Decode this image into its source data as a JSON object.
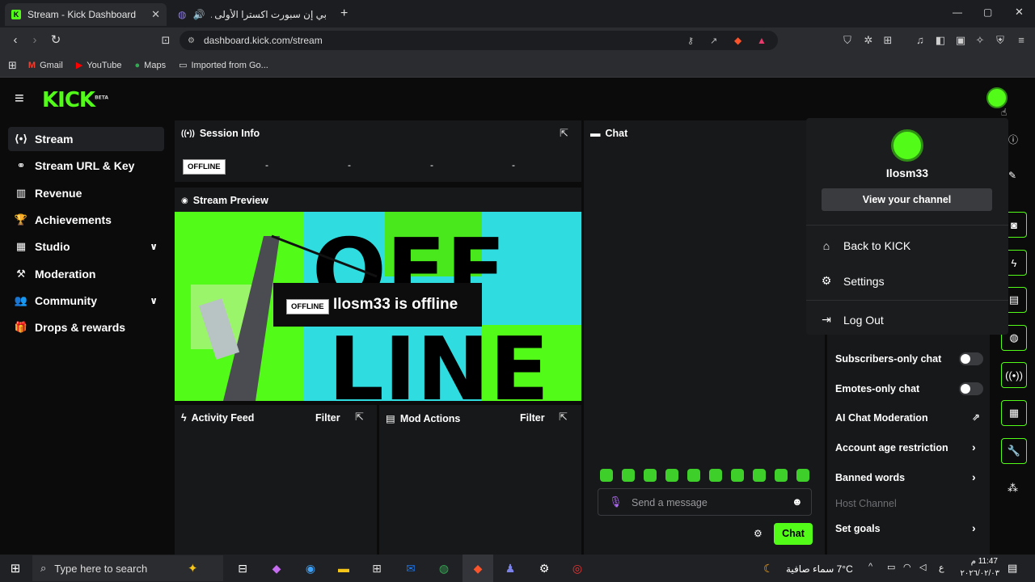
{
  "browser": {
    "tabs": [
      {
        "title": "Stream - Kick Dashboard",
        "active": true
      },
      {
        "title": "بي إن سبورت اكسترا الأولى PANDA",
        "active": false
      }
    ],
    "url": "dashboard.kick.com/stream",
    "bookmarks": [
      "Gmail",
      "YouTube",
      "Maps",
      "Imported from Go..."
    ]
  },
  "app": {
    "logo": "KICK",
    "logo_badge": "BETA",
    "sidebar": {
      "items": [
        {
          "label": "Stream",
          "icon": "broadcast-icon"
        },
        {
          "label": "Stream URL & Key",
          "icon": "link-icon"
        },
        {
          "label": "Revenue",
          "icon": "chart-icon"
        },
        {
          "label": "Achievements",
          "icon": "trophy-icon"
        },
        {
          "label": "Studio",
          "icon": "studio-icon"
        },
        {
          "label": "Moderation",
          "icon": "hammer-icon"
        },
        {
          "label": "Community",
          "icon": "people-icon"
        },
        {
          "label": "Drops & rewards",
          "icon": "gift-icon"
        }
      ]
    },
    "session": {
      "title": "Session Info",
      "status": "OFFLINE",
      "stats": [
        "-",
        "-",
        "-",
        "-"
      ]
    },
    "preview": {
      "title": "Stream Preview",
      "badge": "OFFLINE",
      "message": "Ilosm33 is offline"
    },
    "activity": {
      "title": "Activity Feed",
      "filter": "Filter"
    },
    "mod_actions": {
      "title": "Mod Actions",
      "filter": "Filter"
    },
    "chat": {
      "title": "Chat",
      "placeholder": "Send a message",
      "send_label": "Chat"
    },
    "user_menu": {
      "username": "Ilosm33",
      "view_channel": "View your channel",
      "items": [
        "Back to KICK",
        "Settings",
        "Log Out"
      ]
    },
    "mod_settings": {
      "subscribers_only": {
        "label": "Subscribers-only chat",
        "enabled": false
      },
      "emotes_only": {
        "label": "Emotes-only chat",
        "enabled": false
      },
      "ai_moderation": "AI Chat Moderation",
      "account_age": "Account age restriction",
      "banned_words": "Banned words",
      "host_channel": "Host Channel",
      "set_goals": "Set goals"
    }
  },
  "taskbar": {
    "search_placeholder": "Type here to search",
    "weather": "7°C سماء صافية",
    "time": "11:47 م",
    "date": "٢٠٢٦/٠٢/٠٣",
    "lang": "ع"
  },
  "colors": {
    "accent": "#53fc18",
    "panel": "#17181a",
    "background": "#0b0b0c"
  }
}
